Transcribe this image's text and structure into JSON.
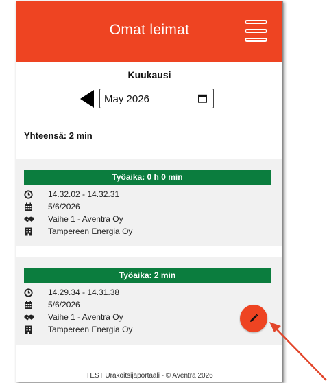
{
  "header": {
    "title": "Omat leimat",
    "menu_icon": "hamburger-menu-icon"
  },
  "month_picker": {
    "label": "Kuukausi",
    "value": "May 2026",
    "prev_icon": "triangle-left-icon",
    "calendar_icon": "calendar-icon"
  },
  "total": {
    "text": "Yhteensä: 2 min"
  },
  "entries": [
    {
      "worktime": "Työaika: 0 h 0 min",
      "time_range": "14.32.02 - 14.32.31",
      "date": "5/6/2026",
      "phase": "Vaihe 1 - Aventra Oy",
      "company": "Tampereen Energia Oy"
    },
    {
      "worktime": "Työaika: 2 min",
      "time_range": "14.29.34 - 14.31.38",
      "date": "5/6/2026",
      "phase": "Vaihe 1 - Aventra Oy",
      "company": "Tampereen Energia Oy"
    }
  ],
  "edit_button": {
    "icon": "pencil-icon"
  },
  "footer": {
    "text": "TEST Urakoitsijaportaali - © Aventra 2026"
  },
  "colors": {
    "accent": "#ee4422",
    "worktime_bar": "#0b7d3e",
    "entry_bg": "#f1f1f1",
    "annotation_arrow": "#e2452a"
  }
}
